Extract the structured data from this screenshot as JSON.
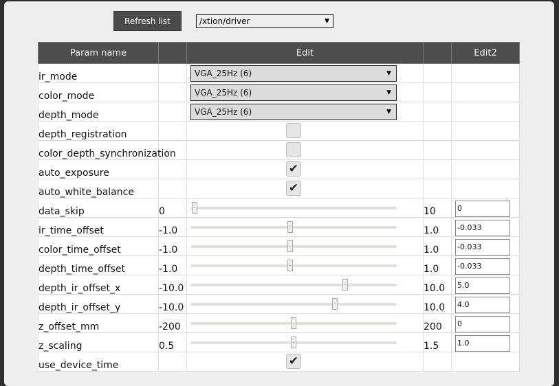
{
  "toolbar": {
    "refresh_label": "Refresh list",
    "node_selected": "/xtion/driver"
  },
  "table": {
    "headers": [
      "Param name",
      "",
      "Edit",
      "",
      "Edit2"
    ],
    "rows": [
      {
        "name": "ir_mode",
        "type": "enum",
        "value": "VGA_25Hz (6)"
      },
      {
        "name": "color_mode",
        "type": "enum",
        "value": "VGA_25Hz (6)"
      },
      {
        "name": "depth_mode",
        "type": "enum",
        "value": "VGA_25Hz (6)"
      },
      {
        "name": "depth_registration",
        "type": "bool",
        "checked": false
      },
      {
        "name": "color_depth_synchronization",
        "type": "bool",
        "checked": false
      },
      {
        "name": "auto_exposure",
        "type": "bool",
        "checked": true
      },
      {
        "name": "auto_white_balance",
        "type": "bool",
        "checked": true
      },
      {
        "name": "data_skip",
        "type": "num",
        "min": "0",
        "max": "10",
        "value": "0",
        "level": 0.02
      },
      {
        "name": "ir_time_offset",
        "type": "num",
        "min": "-1.0",
        "max": "1.0",
        "value": "-0.033",
        "level": 0.483
      },
      {
        "name": "color_time_offset",
        "type": "num",
        "min": "-1.0",
        "max": "1.0",
        "value": "-0.033",
        "level": 0.483
      },
      {
        "name": "depth_time_offset",
        "type": "num",
        "min": "-1.0",
        "max": "1.0",
        "value": "-0.033",
        "level": 0.483
      },
      {
        "name": "depth_ir_offset_x",
        "type": "num",
        "min": "-10.0",
        "max": "10.0",
        "value": "5.0",
        "level": 0.75
      },
      {
        "name": "depth_ir_offset_y",
        "type": "num",
        "min": "-10.0",
        "max": "10.0",
        "value": "4.0",
        "level": 0.7
      },
      {
        "name": "z_offset_mm",
        "type": "num",
        "min": "-200",
        "max": "200",
        "value": "0",
        "level": 0.5
      },
      {
        "name": "z_scaling",
        "type": "num",
        "min": "0.5",
        "max": "1.5",
        "value": "1.0",
        "level": 0.5
      },
      {
        "name": "use_device_time",
        "type": "bool",
        "checked": true
      }
    ]
  },
  "icons": {
    "check": "checkmark-icon",
    "dropdown": "triangle-down-icon"
  }
}
